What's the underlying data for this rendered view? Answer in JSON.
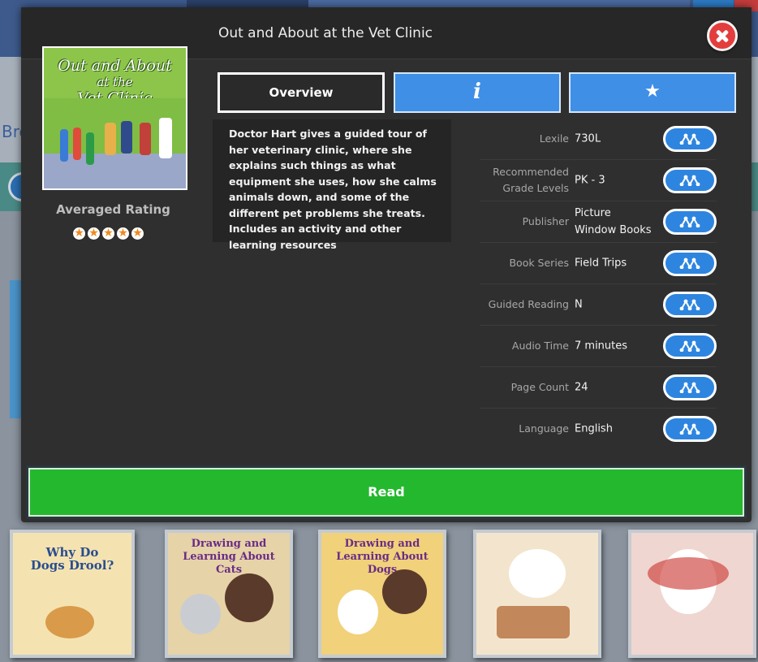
{
  "background": {
    "partial_text": "Bro",
    "shelf_books": [
      {
        "title": "Why Do\nDogs Drool?",
        "bg": "#f4e3b0"
      },
      {
        "title": "Drawing and Learning About Cats",
        "bg": "#e6d3a8"
      },
      {
        "title": "Drawing and Learning About Dogs",
        "bg": "#f1d17a"
      },
      {
        "title": "",
        "bg": "#f3e5cd"
      },
      {
        "title": "",
        "bg": "#efd6d0"
      }
    ]
  },
  "modal": {
    "title": "Out and About at the Vet Clinic",
    "cover": {
      "title_line1": "Out and About",
      "title_line2": "at the",
      "title_line3": "Vet Clinic"
    },
    "rating": {
      "label": "Averaged Rating",
      "stars": 5
    },
    "tabs": {
      "overview": "Overview",
      "info_icon": "info-icon",
      "fav_icon": "star-icon"
    },
    "description": "Doctor Hart gives a guided tour of her veterinary clinic, where she explains such things as what equipment she uses, how she calms animals down, and some of the different pet problems she treats. Includes an activity and other learning resources",
    "metadata": [
      {
        "label": "Lexile",
        "value": "730L"
      },
      {
        "label": "Recommended Grade Levels",
        "value": "PK - 3"
      },
      {
        "label": "Publisher",
        "value": "Picture Window Books"
      },
      {
        "label": "Book Series",
        "value": "Field Trips"
      },
      {
        "label": "Guided Reading",
        "value": "N"
      },
      {
        "label": "Audio Time",
        "value": "7 minutes"
      },
      {
        "label": "Page Count",
        "value": "24"
      },
      {
        "label": "Language",
        "value": "English"
      }
    ],
    "read_label": "Read"
  },
  "colors": {
    "accent_blue": "#3f8fe6",
    "read_green": "#24b82f",
    "close_red": "#e33d3d",
    "star_orange": "#f08a1e"
  }
}
